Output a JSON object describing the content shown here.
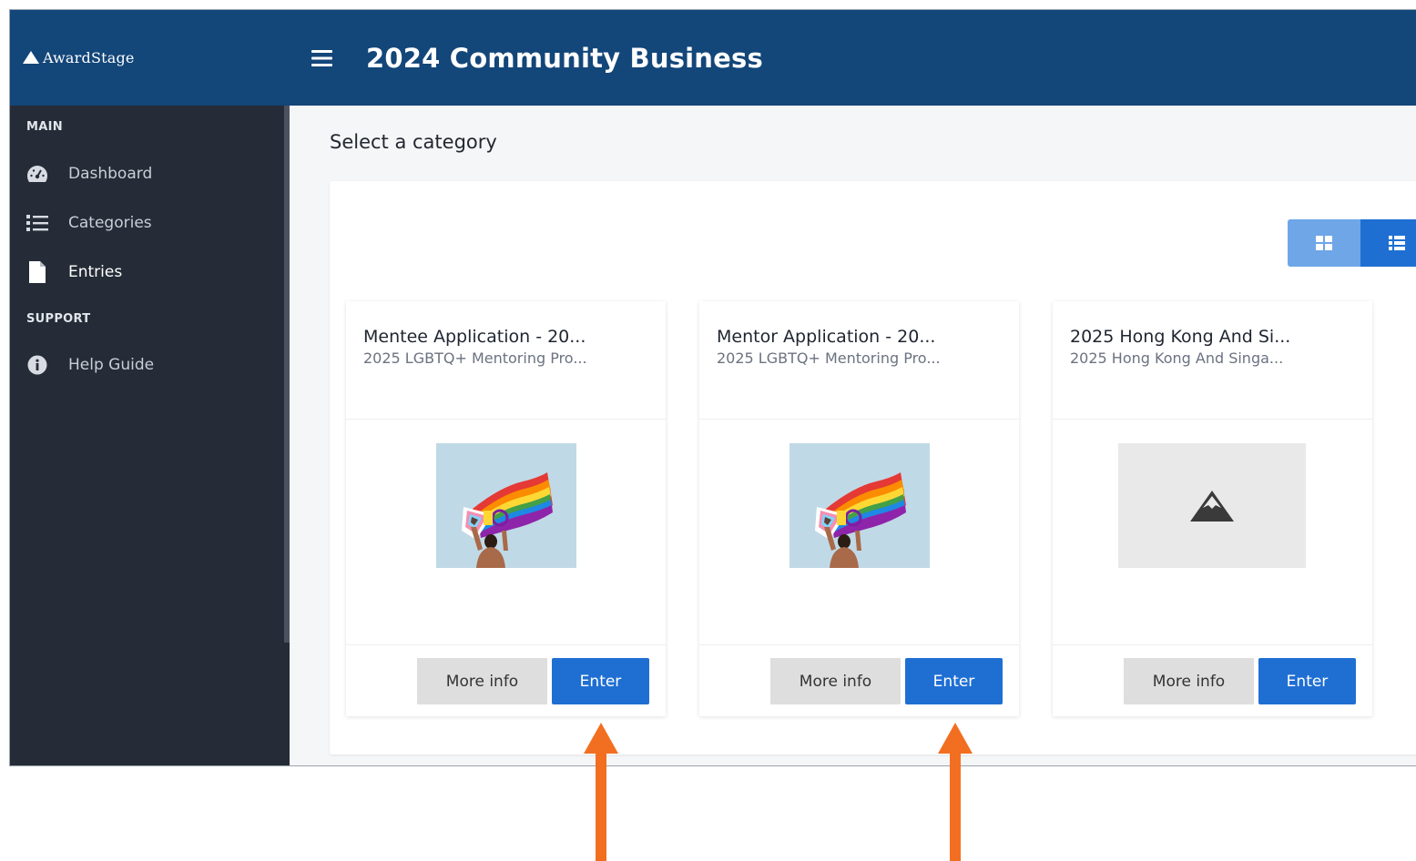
{
  "app": {
    "brand": "AwardStage",
    "title": "2024 Community Business"
  },
  "sidebar": {
    "sections": [
      {
        "heading": "MAIN",
        "items": [
          {
            "label": "Dashboard",
            "icon": "dashboard-gauge-icon",
            "active": false
          },
          {
            "label": "Categories",
            "icon": "list-icon",
            "active": false
          },
          {
            "label": "Entries",
            "icon": "file-icon",
            "active": true
          }
        ]
      },
      {
        "heading": "SUPPORT",
        "items": [
          {
            "label": "Help Guide",
            "icon": "info-circle-icon",
            "active": false
          }
        ]
      }
    ]
  },
  "main": {
    "section_title": "Select a category",
    "view_toggle": {
      "options": [
        "grid-view-icon",
        "list-view-icon"
      ]
    },
    "cards": [
      {
        "title": "Mentee Application - 20...",
        "subtitle": "2025 LGBTQ+ Mentoring Pro...",
        "image": "pride-flag-photo",
        "more_label": "More info",
        "enter_label": "Enter"
      },
      {
        "title": "Mentor Application - 20...",
        "subtitle": "2025 LGBTQ+ Mentoring Pro...",
        "image": "pride-flag-photo",
        "more_label": "More info",
        "enter_label": "Enter"
      },
      {
        "title": "2025 Hong Kong And Si...",
        "subtitle": "2025 Hong Kong And Singa...",
        "image": "placeholder-mountain-icon",
        "more_label": "More info",
        "enter_label": "Enter"
      }
    ]
  },
  "annotations": {
    "arrow_color": "#f26f21",
    "arrows": [
      "enter-button-card-1",
      "enter-button-card-2"
    ]
  },
  "colors": {
    "topbar": "#134679",
    "sidebar": "#252c37",
    "primary": "#1f6fd3",
    "secondary_button": "#dedede"
  }
}
